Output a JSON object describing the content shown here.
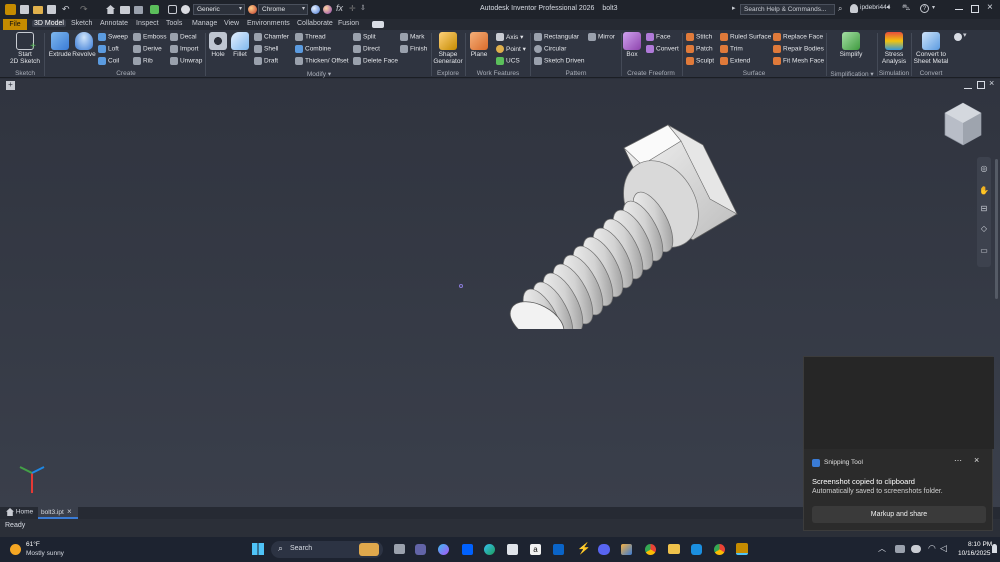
{
  "titlebar": {
    "app_title": "Autodesk Inventor Professional 2026",
    "doc_title": "bolt3",
    "appearance": "Generic",
    "material": "Chrome",
    "search_placeholder": "Search Help & Commands...",
    "user": "ipdebri444"
  },
  "menu": {
    "file": "File",
    "tabs": [
      "3D Model",
      "Sketch",
      "Annotate",
      "Inspect",
      "Tools",
      "Manage",
      "View",
      "Environments",
      "Collaborate",
      "Fusion"
    ]
  },
  "ribbon": {
    "sketch": {
      "start": "Start",
      "start2": "2D Sketch",
      "group": "Sketch"
    },
    "create": {
      "extrude": "Extrude",
      "revolve": "Revolve",
      "sweep": "Sweep",
      "loft": "Loft",
      "coil": "Coil",
      "emboss": "Emboss",
      "derive": "Derive",
      "rib": "Rib",
      "decal": "Decal",
      "import": "Import",
      "unwrap": "Unwrap",
      "group": "Create"
    },
    "modify": {
      "hole": "Hole",
      "fillet": "Fillet",
      "chamfer": "Chamfer",
      "shell": "Shell",
      "draft": "Draft",
      "thread": "Thread",
      "combine": "Combine",
      "thicken": "Thicken/ Offset",
      "split": "Split",
      "direct": "Direct",
      "delete_face": "Delete Face",
      "mark": "Mark",
      "finish": "Finish",
      "group": "Modify"
    },
    "explore": {
      "shape": "Shape",
      "generator": "Generator",
      "group": "Explore"
    },
    "work": {
      "plane": "Plane",
      "axis": "Axis",
      "point": "Point",
      "ucs": "UCS",
      "group": "Work Features"
    },
    "pattern": {
      "rectangular": "Rectangular",
      "circular": "Circular",
      "sketch_driven": "Sketch Driven",
      "mirror": "Mirror",
      "group": "Pattern"
    },
    "freeform": {
      "box": "Box",
      "face": "Face",
      "convert": "Convert",
      "group": "Create Freeform"
    },
    "surface": {
      "stitch": "Stitch",
      "patch": "Patch",
      "sculpt": "Sculpt",
      "ruled": "Ruled Surface",
      "trim": "Trim",
      "extend": "Extend",
      "replace": "Replace Face",
      "repair": "Repair Bodies",
      "fit_mesh": "Fit Mesh Face",
      "group": "Surface"
    },
    "simplification": {
      "simplify": "Simplify",
      "group": "Simplification"
    },
    "simulation": {
      "stress": "Stress",
      "analysis": "Analysis",
      "group": "Simulation"
    },
    "convert": {
      "to": "Convert to",
      "sheet": "Sheet Metal",
      "group": "Convert"
    }
  },
  "doctabs": {
    "home": "Home",
    "doc": "bolt3.ipt"
  },
  "status": {
    "text": "Ready"
  },
  "toast": {
    "app": "Snipping Tool",
    "title": "Screenshot copied to clipboard",
    "body": "Automatically saved to screenshots folder.",
    "button": "Markup and share"
  },
  "taskbar": {
    "temp": "61°F",
    "weather": "Mostly sunny",
    "search_placeholder": "Search",
    "time": "8:10 PM",
    "date": "10/16/2025"
  },
  "colors": {
    "file_tab": "#c58b00",
    "accent": "#3a7bd5"
  }
}
